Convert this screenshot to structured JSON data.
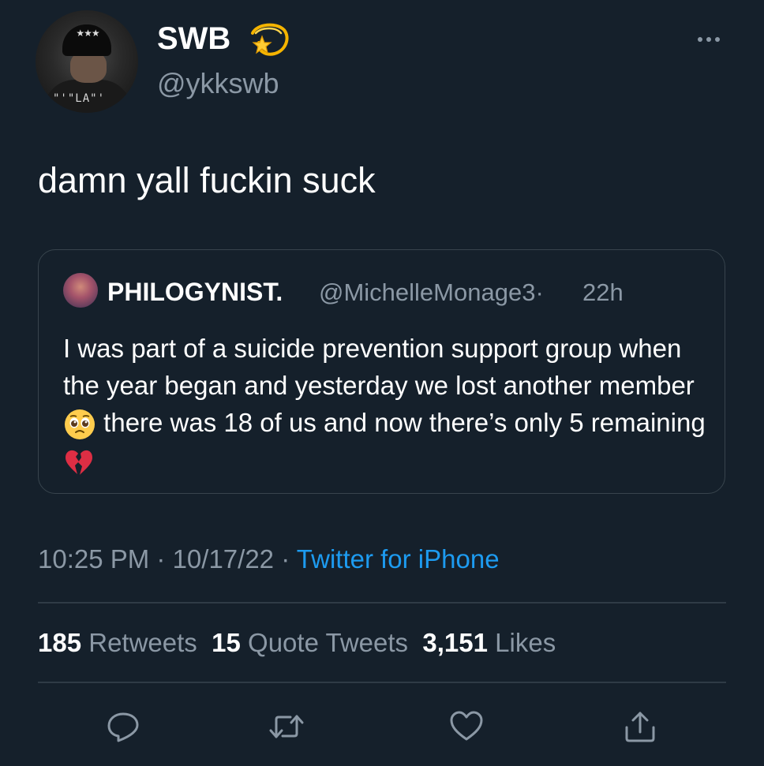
{
  "author": {
    "display_name": "SWB",
    "handle": "@ykkswb",
    "avatar_print": "★★★",
    "shirt_print": "\"'\"LA\"'"
  },
  "tweet": {
    "text": "damn yall fuckin suck"
  },
  "quoted": {
    "name": "PHILOGYNIST.",
    "handle": "@MichelleMonage3",
    "separator": "·",
    "time": "22h",
    "text_part1": "I was part of a suicide prevention support group when the year began and yesterday we lost another member",
    "text_part2": " there was 18 of us and now there’s only 5 remaining",
    "emoji1": "pleading-face",
    "emoji2": "broken-heart"
  },
  "meta": {
    "time": "10:25 PM",
    "sep1": " · ",
    "date": "10/17/22",
    "sep2": " · ",
    "source": "Twitter for iPhone"
  },
  "stats": {
    "retweets_count": "185",
    "retweets_label": "Retweets",
    "quotes_count": "15",
    "quotes_label": "Quote Tweets",
    "likes_count": "3,151",
    "likes_label": "Likes"
  },
  "colors": {
    "background": "#15202b",
    "secondary_text": "#8b98a5",
    "link": "#1d9bf0",
    "border": "#38444d"
  }
}
